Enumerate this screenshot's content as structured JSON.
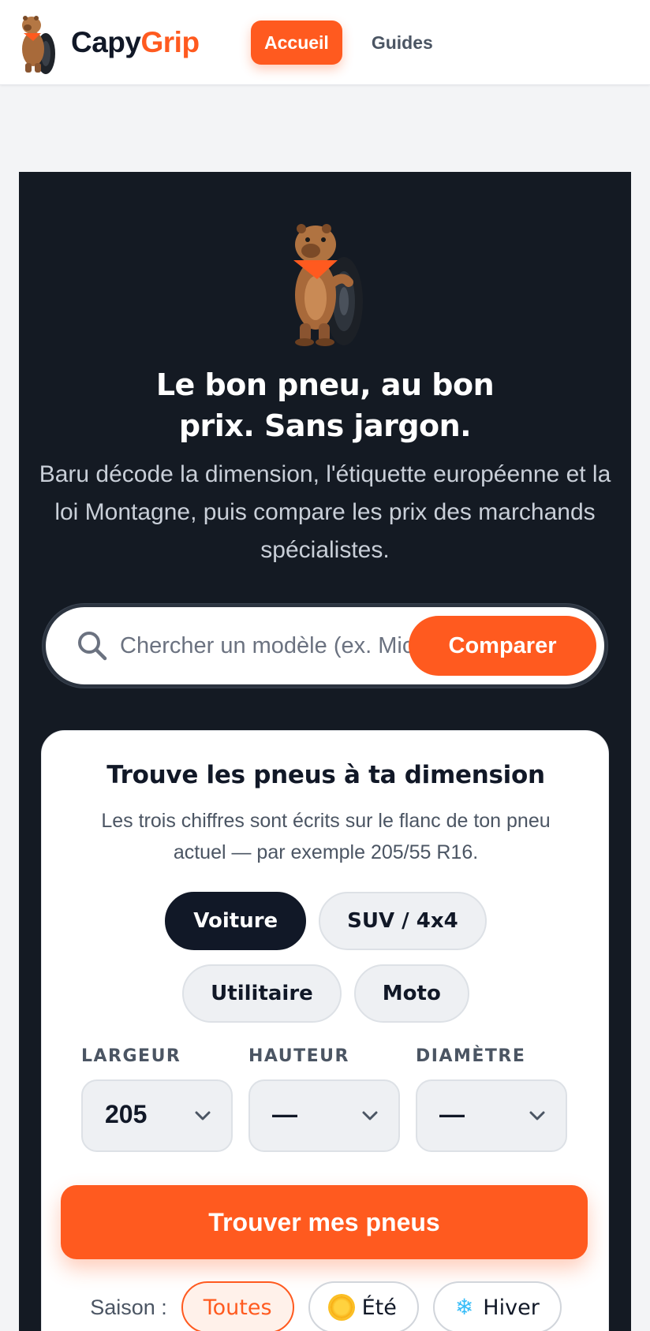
{
  "app": {
    "brand_part1": "Capy",
    "brand_part2": "Grip",
    "brand_color": "#ff5a1f"
  },
  "nav": {
    "items": [
      {
        "label": "Accueil",
        "active": true
      },
      {
        "label": "Guides",
        "active": false
      }
    ]
  },
  "hero": {
    "title_line1": "Le bon pneu, au bon",
    "title_line2": "prix. Sans jargon.",
    "subtitle": "Baru décode la dimension, l'étiquette européenne et la loi Montagne, puis compare les prix des marchands spécialistes."
  },
  "search": {
    "icon": "search-icon",
    "placeholder": "Chercher un modèle (ex. Michelin…)",
    "value": "",
    "button_label": "Comparer"
  },
  "finder": {
    "title": "Trouve les pneus à ta dimension",
    "subtitle": "Les trois chiffres sont écrits sur le flanc de ton pneu actuel — par exemple 205/55 R16.",
    "vehicle_types": [
      {
        "label": "Voiture",
        "active": true
      },
      {
        "label": "SUV / 4x4",
        "active": false
      },
      {
        "label": "Utilitaire",
        "active": false
      },
      {
        "label": "Moto",
        "active": false
      }
    ],
    "dimensions": [
      {
        "label": "LARGEUR",
        "value": "205"
      },
      {
        "label": "HAUTEUR",
        "value": "—"
      },
      {
        "label": "DIAMÈTRE",
        "value": "—"
      }
    ],
    "submit_label": "Trouver mes pneus",
    "season": {
      "label": "Saison :",
      "options": [
        {
          "label": "Toutes",
          "active": true,
          "icon": ""
        },
        {
          "label": "Été",
          "active": false,
          "icon": "sun-icon"
        },
        {
          "label": "Hiver",
          "active": false,
          "icon": "snowflake-icon"
        }
      ],
      "snowflake_glyph": "❄"
    }
  },
  "colors": {
    "accent": "#ff5a1f",
    "hero_bg": "#141a23",
    "dark_chip": "#111827"
  }
}
